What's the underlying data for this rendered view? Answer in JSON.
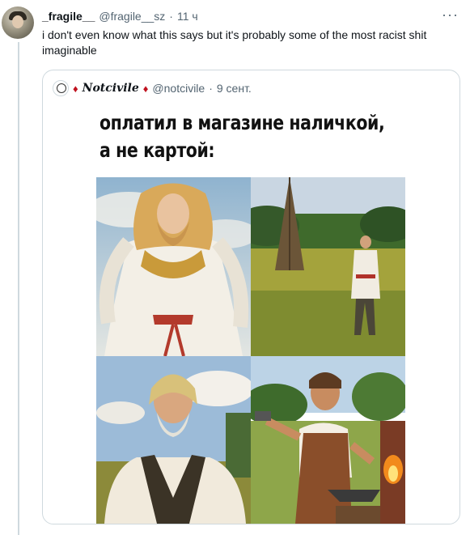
{
  "tweet": {
    "author_name": "_fragile__",
    "handle": "@fragile__sz",
    "separator": "·",
    "time": "11 ч",
    "more_label": "···",
    "text": "i don't even know what this says but it's probably some of the most racist shit imaginable"
  },
  "quote": {
    "diamond_left": "♦",
    "author_name": "Notcivile",
    "diamond_right": "♦",
    "handle": "@notcivile",
    "separator": "·",
    "date": "9 сент.",
    "meme": {
      "caption_line1": "оплатил в магазине наличкой,",
      "caption_line2": "а не картой:",
      "panels": [
        "god-figure-painting",
        "man-in-field-photo",
        "bearded-peasant-painting",
        "blacksmith-painting"
      ]
    }
  },
  "colors": {
    "text": "#0f1419",
    "muted": "#536471",
    "border": "#cfd9de",
    "diamond": "#c0121f"
  }
}
